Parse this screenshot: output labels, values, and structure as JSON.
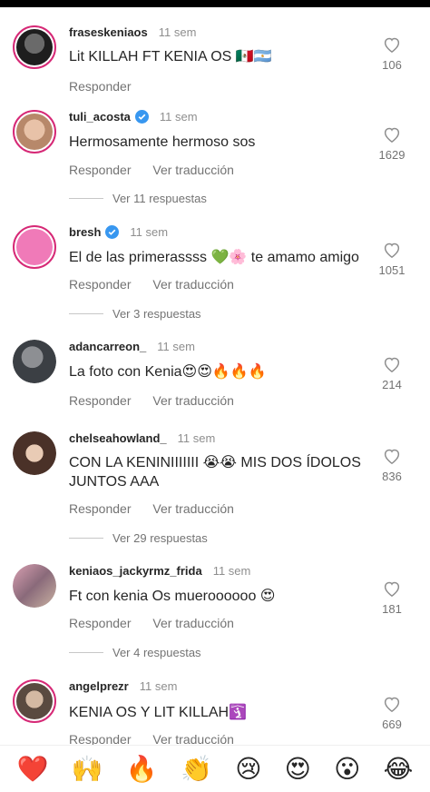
{
  "comments": [
    {
      "username": "fraseskeniaos",
      "time": "11 sem",
      "text": "Lit KILLAH FT KENIA OS 🇲🇽🇦🇷",
      "likes": "106",
      "reply_label": "Responder",
      "avatar_color": "#3a3a3a"
    },
    {
      "username": "tuli_acosta",
      "time": "11 sem",
      "text": "Hermosamente hermoso sos",
      "likes": "1629",
      "reply_label": "Responder",
      "translate_label": "Ver traducción",
      "avatar_color": "#caa48a"
    },
    {
      "username": "bresh",
      "time": "11 sem",
      "text": "El de las primerassss 💚🌸 te amamo amigo",
      "likes": "1051",
      "reply_label": "Responder",
      "translate_label": "Ver traducción",
      "avatar_color": "#f07ab8"
    },
    {
      "username": "adancarreon_",
      "time": "11 sem",
      "text": "La foto con Kenia😍😍🔥🔥🔥",
      "likes": "214",
      "reply_label": "Responder",
      "translate_label": "Ver traducción",
      "avatar_color": "#4a4f55"
    },
    {
      "username": "chelseahowland_",
      "time": "11 sem",
      "text": "CON LA KENINIIIIIII 😭😭 MIS DOS ÍDOLOS JUNTOS AAA",
      "likes": "836",
      "reply_label": "Responder",
      "translate_label": "Ver traducción",
      "avatar_color": "#6b4b3e"
    },
    {
      "username": "keniaos_jackyrmz_frida",
      "time": "11 sem",
      "text": "Ft con kenia Os mueroooooo 😍",
      "likes": "181",
      "reply_label": "Responder",
      "translate_label": "Ver traducción",
      "avatar_color": "#b07a8c"
    },
    {
      "username": "angelprezr",
      "time": "11 sem",
      "text": "KENIA OS Y LIT KILLAH🛐",
      "likes": "669",
      "reply_label": "Responder",
      "translate_label": "Ver traducción",
      "avatar_color": "#8a7565"
    }
  ],
  "replies": [
    {
      "label": "Ver 11 respuestas"
    },
    {
      "label": "Ver 3 respuestas"
    },
    {
      "label": "Ver 29 respuestas"
    },
    {
      "label": "Ver 4 respuestas"
    }
  ],
  "emoji_bar": [
    "❤️",
    "🙌",
    "🔥",
    "👏",
    "😢",
    "😍",
    "😮",
    "😂"
  ],
  "colors": {
    "verified": "#3897f0",
    "story_ring": "#d62976",
    "heart_outline": "#8e8e8e"
  }
}
